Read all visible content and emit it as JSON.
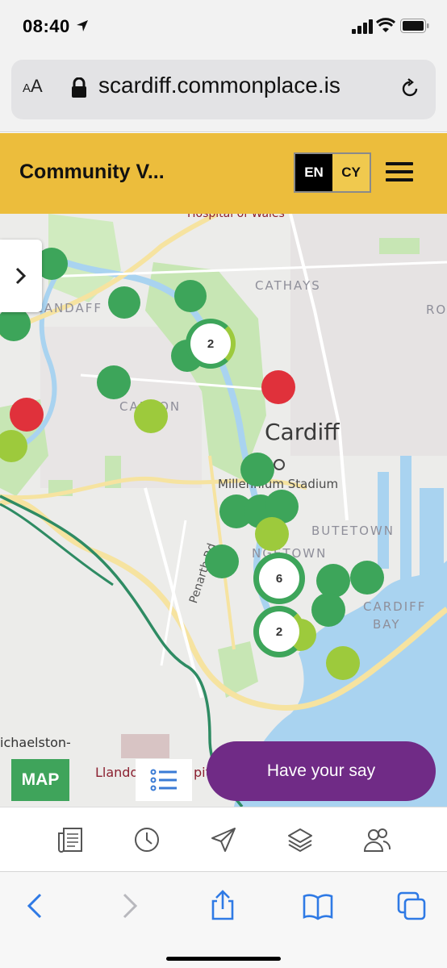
{
  "status_bar": {
    "time": "08:40",
    "icons": [
      "location-arrow-icon",
      "signal-icon",
      "wifi-icon",
      "battery-icon"
    ]
  },
  "browser": {
    "text_size_button": "AA",
    "url": "scardiff.commonplace.is",
    "lock_icon": "lock-icon",
    "reload_icon": "reload-icon"
  },
  "header": {
    "title": "Community V...",
    "lang_en": "EN",
    "lang_cy": "CY",
    "menu_icon": "hamburger-menu-icon",
    "background_color": "#ecbd3c"
  },
  "map": {
    "labels": {
      "hospital": "Hospital of Wales",
      "cathays": "CATHAYS",
      "ro": "RO",
      "landaff": "LANDAFF",
      "canton": "CANTON",
      "cardiff": "Cardiff",
      "stadium": "Millennium Stadium",
      "butetown": "BUTETOWN",
      "grangetown": "NGETOWN",
      "cardiff_bay_1": "CARDIFF",
      "cardiff_bay_2": "BAY",
      "penarth_rd": "Penarth Rd",
      "michaelston": "ichaelston-",
      "llandough": "Llando",
      "llandough_tail": "pita"
    },
    "clusters": [
      {
        "count": "2"
      },
      {
        "count": "6"
      },
      {
        "count": "2"
      }
    ],
    "colors": {
      "positive": "#3da55a",
      "mixed": "#9dca3c",
      "negative": "#e0313b",
      "water": "#a9d3f0",
      "park": "#c7e6b4",
      "road": "#f6e3a0"
    },
    "sidebar_toggle_icon": "chevron-right-icon",
    "map_badge": "MAP",
    "list_icon": "list-icon",
    "cta": "Have your say"
  },
  "app_nav": {
    "items": [
      "news-icon",
      "history-icon",
      "send-icon",
      "layers-icon",
      "people-icon"
    ]
  },
  "safari_toolbar": {
    "items": [
      "back-icon",
      "forward-icon",
      "share-icon",
      "bookmarks-icon",
      "tabs-icon"
    ]
  }
}
